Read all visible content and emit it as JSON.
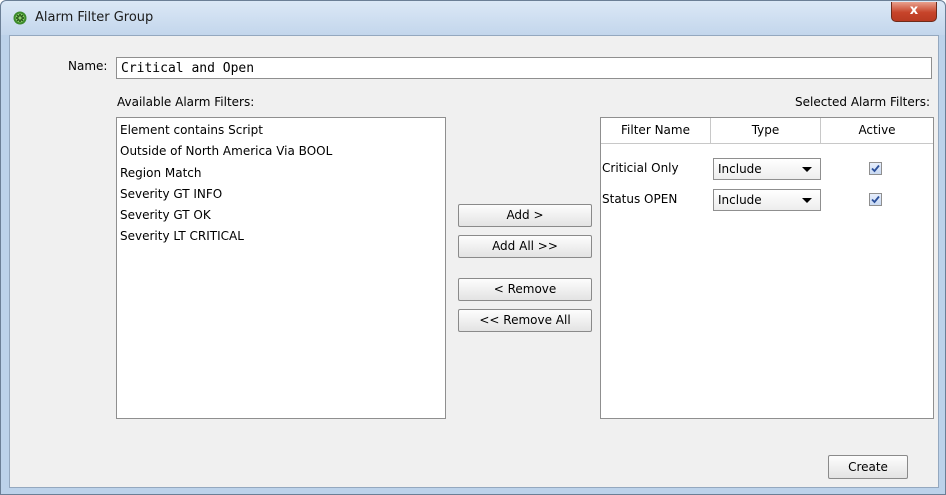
{
  "window": {
    "title": "Alarm Filter Group",
    "close_label": "x"
  },
  "form": {
    "name_label": "Name:",
    "name_value": "Critical and Open"
  },
  "available": {
    "label": "Available Alarm Filters:",
    "items": [
      {
        "label": "Element contains Script"
      },
      {
        "label": "Outside of North America Via BOOL"
      },
      {
        "label": "Region Match"
      },
      {
        "label": "Severity GT INFO"
      },
      {
        "label": "Severity GT OK"
      },
      {
        "label": "Severity LT CRITICAL"
      }
    ]
  },
  "buttons": {
    "add": "Add >",
    "add_all": "Add All >>",
    "remove": "< Remove",
    "remove_all": "<< Remove All",
    "create": "Create"
  },
  "selected": {
    "label": "Selected Alarm Filters:",
    "columns": [
      "Filter Name",
      "Type",
      "Active"
    ],
    "rows": [
      {
        "name": "Criticial Only",
        "type": "Include",
        "active": true
      },
      {
        "name": "Status OPEN",
        "type": "Include",
        "active": true
      }
    ]
  },
  "colors": {
    "title_bar": "#c3d6ec",
    "close_button": "#c7442a",
    "panel_background": "#f0f0f0",
    "checkbox_check": "#2b4f9a"
  },
  "icons": {
    "app": "gear-icon",
    "close": "close-icon",
    "dropdown": "chevron-down-icon",
    "checkbox": "checkmark-icon"
  }
}
